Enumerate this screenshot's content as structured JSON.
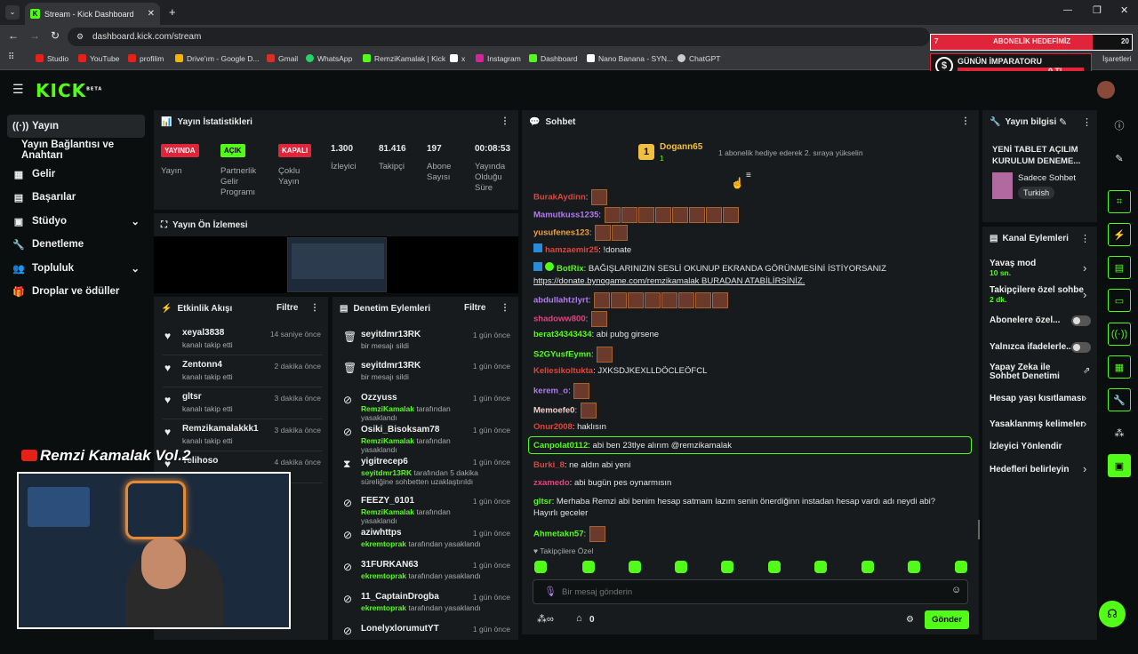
{
  "browser": {
    "tab_title": "Stream - Kick Dashboard",
    "url": "dashboard.kick.com/stream",
    "bookmarks": [
      "Studio",
      "YouTube",
      "profilim",
      "Drive'ım - Google D...",
      "Gmail",
      "WhatsApp",
      "RemziKamalak | Kick",
      "x",
      "Instagram",
      "Dashboard",
      "Nano Banana - SYN...",
      "ChatGPT"
    ],
    "bookmarks_other": "İşaretleri"
  },
  "overlay": {
    "goal_left": "7",
    "goal_title": "ABONELİK HEDEFİMİZ",
    "goal_right": "20",
    "emperor_title": "GÜNÜN İMPARATORU",
    "emperor_name": "-",
    "emperor_amount": "0 TL",
    "channel_name": "Remzi Kamalak Vol.2"
  },
  "sidebar": {
    "items": [
      {
        "label": "Yayın",
        "icon": "broadcast-icon"
      },
      {
        "label": "Yayın Bağlantısı ve Anahtarı",
        "icon": ""
      },
      {
        "label": "Gelir",
        "icon": "revenue-icon"
      },
      {
        "label": "Başarılar",
        "icon": "achievements-icon"
      },
      {
        "label": "Stüdyo",
        "icon": "studio-icon"
      },
      {
        "label": "Denetleme",
        "icon": "wrench-icon"
      },
      {
        "label": "Topluluk",
        "icon": "community-icon"
      },
      {
        "label": "Droplar ve ödüller",
        "icon": "gift-icon"
      }
    ]
  },
  "stats": {
    "title": "Yayın İstatistikleri",
    "live_badge": "YAYINDA",
    "live_label": "Yayın",
    "partner_badge": "AÇIK",
    "partner_label": "Partnerlik Gelir Programı",
    "multi_badge": "KAPALI",
    "multi_label": "Çoklu Yayın",
    "viewers": "1.300",
    "viewers_label": "İzleyici",
    "followers": "81.416",
    "followers_label": "Takipçi",
    "subs": "197",
    "subs_label": "Abone Sayısı",
    "uptime": "00:08:53",
    "uptime_label": "Yayında Olduğu Süre"
  },
  "preview": {
    "title": "Yayın Ön İzlemesi"
  },
  "activity": {
    "title": "Etkinlik Akışı",
    "filter": "Filtre",
    "items": [
      {
        "name": "xeyal3838",
        "sub": "kanalı takip etti",
        "time": "14 saniye önce"
      },
      {
        "name": "Zentonn4",
        "sub": "kanalı takip etti",
        "time": "2 dakika önce"
      },
      {
        "name": "gltsr",
        "sub": "kanalı takip etti",
        "time": "3 dakika önce"
      },
      {
        "name": "Remzikamalakkk1",
        "sub": "kanalı takip etti",
        "time": "3 dakika önce"
      },
      {
        "name": "Telihoso",
        "sub": "",
        "time": "4 dakika önce"
      }
    ]
  },
  "moderation": {
    "title": "Denetim Eylemleri",
    "filter": "Filtre",
    "items": [
      {
        "name": "seyitdmr13RK",
        "by": "",
        "sub": "bir mesajı sildi",
        "time": "1 gün önce",
        "icon": "trash-icon"
      },
      {
        "name": "seyitdmr13RK",
        "by": "",
        "sub": "bir mesajı sildi",
        "time": "1 gün önce",
        "icon": "trash-icon"
      },
      {
        "name": "Ozzyuss",
        "by": "RemziKamalak",
        "sub": "tarafından yasaklandı",
        "time": "1 gün önce",
        "icon": "ban-icon"
      },
      {
        "name": "Osiki_Bisoksam78",
        "by": "RemziKamalak",
        "sub": "tarafından yasaklandı",
        "time": "1 gün önce",
        "icon": "ban-icon"
      },
      {
        "name": "yigitrecep6",
        "by": "seyitdmr13RK",
        "sub": "tarafından 5 dakika süreliğine sohbetten uzaklaştırıldı",
        "time": "1 gün önce",
        "icon": "hourglass-icon"
      },
      {
        "name": "FEEZY_0101",
        "by": "RemziKamalak",
        "sub": "tarafından yasaklandı",
        "time": "1 gün önce",
        "icon": "ban-icon"
      },
      {
        "name": "aziwhttps",
        "by": "ekremtoprak",
        "sub": "tarafından yasaklandı",
        "time": "1 gün önce",
        "icon": "ban-icon"
      },
      {
        "name": "31FURKAN63",
        "by": "ekremtoprak",
        "sub": "tarafından yasaklandı",
        "time": "1 gün önce",
        "icon": "ban-icon"
      },
      {
        "name": "11_CaptainDrogba",
        "by": "ekremtoprak",
        "sub": "tarafından yasaklandı",
        "time": "1 gün önce",
        "icon": "ban-icon"
      },
      {
        "name": "LonelyxlorumutYT",
        "by": "",
        "sub": "",
        "time": "1 gün önce",
        "icon": "ban-icon"
      }
    ]
  },
  "chat": {
    "title": "Sohbet",
    "pinned_user": "Dogann65",
    "pinned_count": "1",
    "pinned_msg": "1 abonelik hediye ederek 2. sıraya yükselin",
    "messages": [
      {
        "user": "BurakAydinn",
        "color": "#e0443c",
        "text": "",
        "emotes": 1
      },
      {
        "user": "Mamutkuss1235",
        "color": "#b07cf0",
        "text": "",
        "emotes": 8
      },
      {
        "user": "yusufenes123",
        "color": "#f0a03c",
        "text": "",
        "emotes": 2
      },
      {
        "user": "hamzaemir25",
        "color": "#e0443c",
        "text": "!donate",
        "emotes": 0
      },
      {
        "user": "BotRix",
        "color": "#53fc18",
        "text": "BAĞIŞLARINIZIN SESLİ OKUNUP EKRANDA GÖRÜNMESİNİ İSTİYORSANIZ",
        "emotes": 0
      },
      {
        "user": "",
        "color": "",
        "text": "https://donate.bynogame.com/remzikamalak BURADAN ATABİLİRSİNİZ.",
        "emotes": 0
      },
      {
        "user": "abdullahtzlyrt",
        "color": "#b07cf0",
        "text": "",
        "emotes": 8
      },
      {
        "user": "shadoww800",
        "color": "#e04480",
        "text": "",
        "emotes": 1
      },
      {
        "user": "berat34343434",
        "color": "#53fc18",
        "text": "abi pubg girsene",
        "emotes": 0
      },
      {
        "user": "S2GYusfEymn",
        "color": "#53fc18",
        "text": "",
        "emotes": 1
      },
      {
        "user": "Keliesikoltukta",
        "color": "#e0443c",
        "text": "JXKSDJKEXLLDÖCLEÖFCL",
        "emotes": 0
      },
      {
        "user": "kerem_o",
        "color": "#b07cf0",
        "text": "",
        "emotes": 1
      },
      {
        "user": "Memoefe0",
        "color": "#f0d0d0",
        "text": "",
        "emotes": 1
      },
      {
        "user": "Onur2008",
        "color": "#e0443c",
        "text": "haklısın",
        "emotes": 0
      },
      {
        "user": "Canpolat0112",
        "color": "#53fc18",
        "text": "abi ben 23tlye alırım @remzikamalak",
        "emotes": 0
      },
      {
        "user": "Burki_8",
        "color": "#e0443c",
        "text": "ne aldın abi yeni",
        "emotes": 0
      },
      {
        "user": "zxamedo",
        "color": "#e04480",
        "text": "abi bugün pes oynarmısın",
        "emotes": 0
      },
      {
        "user": "gltsr",
        "color": "#53fc18",
        "text": "Merhaba Remzi abi benim hesap satmam lazım senin önerdiğinn instadan hesap vardı adı neydi abi? Hayırlı geceler",
        "emotes": 0
      },
      {
        "user": "Ahmetakn57",
        "color": "#53fc18",
        "text": "",
        "emotes": 1
      }
    ],
    "followers_only": "Takipçilere Özel",
    "input_placeholder": "Bir mesaj gönderin",
    "points": "0",
    "send": "Gönder"
  },
  "info": {
    "title": "Yayın bilgisi",
    "stream_title": "YENİ TABLET AÇILIM KURULUM DENEME...",
    "category": "Sadece Sohbet",
    "language": "Turkish"
  },
  "channel_actions": {
    "title": "Kanal Eylemleri",
    "items": [
      {
        "label": "Yavaş mod",
        "value": "10 sn.",
        "control": "chevron"
      },
      {
        "label": "Takipçilere özel sohbe",
        "value": "2 dk.",
        "control": "chevron"
      },
      {
        "label": "Abonelere özel...",
        "value": "",
        "control": "toggle"
      },
      {
        "label": "Yalnızca ifadelerle...",
        "value": "",
        "control": "toggle"
      },
      {
        "label": "Yapay Zeka ile Sohbet Denetimi",
        "value": "",
        "control": "external"
      },
      {
        "label": "Hesap yaşı kısıtlaması",
        "value": "",
        "control": "chevron"
      },
      {
        "label": "Yasaklanmış kelimeler",
        "value": "",
        "control": "chevron"
      },
      {
        "label": "İzleyici Yönlendir",
        "value": "",
        "control": "none"
      },
      {
        "label": "Hedefleri belirleyin",
        "value": "",
        "control": "chevron"
      }
    ]
  },
  "colors": {
    "accent": "#53fc18",
    "red": "#e0253a",
    "panel": "#181b1d",
    "bg": "#0b0e0f"
  }
}
